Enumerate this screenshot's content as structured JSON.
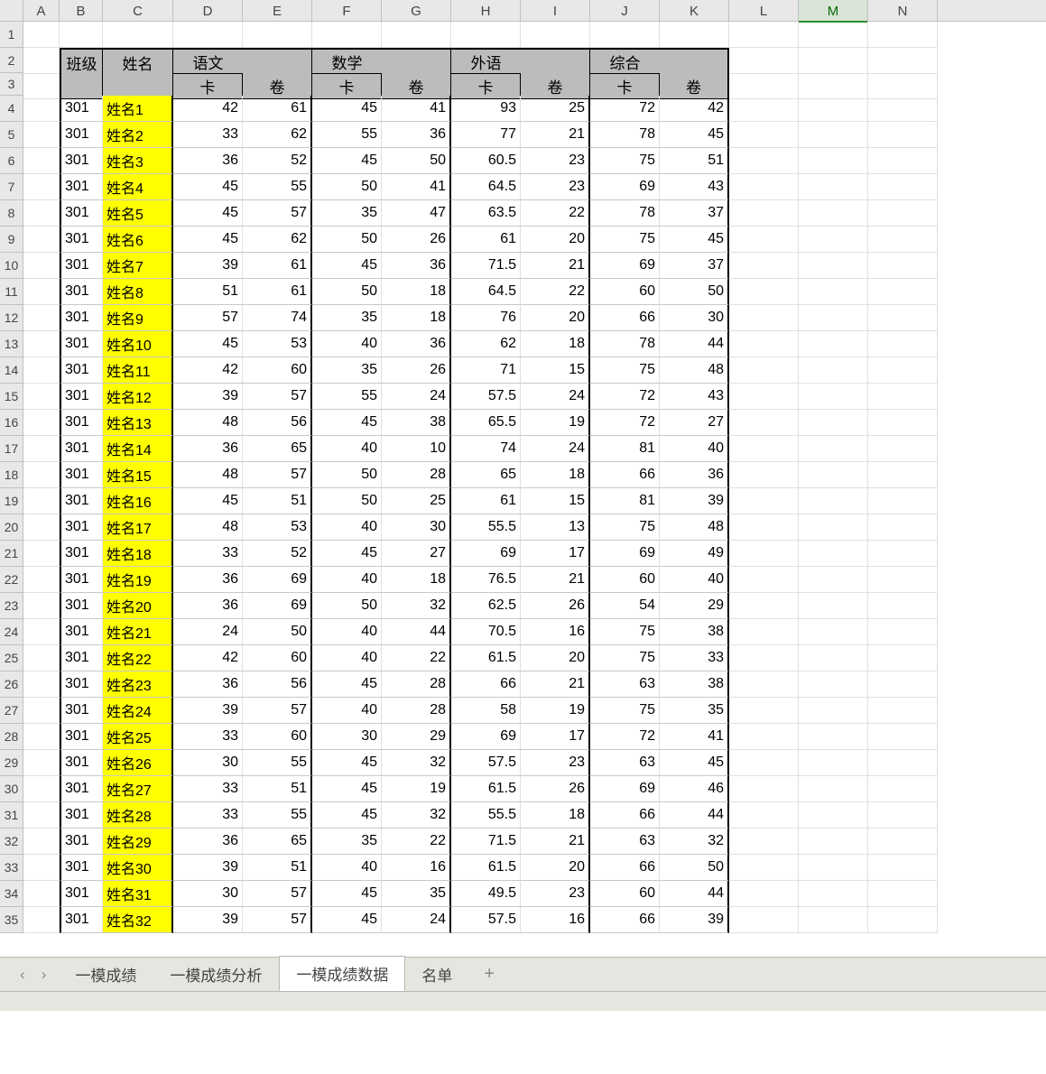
{
  "columns": [
    "A",
    "B",
    "C",
    "D",
    "E",
    "F",
    "G",
    "H",
    "I",
    "J",
    "K",
    "L",
    "M",
    "N"
  ],
  "selected_column": "M",
  "row_numbers_start": 1,
  "row_numbers_end": 35,
  "header": {
    "class_label": "班级",
    "name_label": "姓名",
    "subjects": [
      {
        "label": "语文",
        "sub1": "卡",
        "sub2": "卷"
      },
      {
        "label": "数学",
        "sub1": "卡",
        "sub2": "卷"
      },
      {
        "label": "外语",
        "sub1": "卡",
        "sub2": "卷"
      },
      {
        "label": "综合",
        "sub1": "卡",
        "sub2": "卷"
      }
    ]
  },
  "rows": [
    {
      "class": "301",
      "name": "姓名1",
      "d": 42,
      "e": 61,
      "f": 45,
      "g": 41,
      "h": "93",
      "i": 25,
      "j": 72,
      "k": 42
    },
    {
      "class": "301",
      "name": "姓名2",
      "d": 33,
      "e": 62,
      "f": 55,
      "g": 36,
      "h": "77",
      "i": 21,
      "j": 78,
      "k": 45
    },
    {
      "class": "301",
      "name": "姓名3",
      "d": 36,
      "e": 52,
      "f": 45,
      "g": 50,
      "h": "60.5",
      "i": 23,
      "j": 75,
      "k": 51
    },
    {
      "class": "301",
      "name": "姓名4",
      "d": 45,
      "e": 55,
      "f": 50,
      "g": 41,
      "h": "64.5",
      "i": 23,
      "j": 69,
      "k": 43
    },
    {
      "class": "301",
      "name": "姓名5",
      "d": 45,
      "e": 57,
      "f": 35,
      "g": 47,
      "h": "63.5",
      "i": 22,
      "j": 78,
      "k": 37
    },
    {
      "class": "301",
      "name": "姓名6",
      "d": 45,
      "e": 62,
      "f": 50,
      "g": 26,
      "h": "61",
      "i": 20,
      "j": 75,
      "k": 45
    },
    {
      "class": "301",
      "name": "姓名7",
      "d": 39,
      "e": 61,
      "f": 45,
      "g": 36,
      "h": "71.5",
      "i": 21,
      "j": 69,
      "k": 37
    },
    {
      "class": "301",
      "name": "姓名8",
      "d": 51,
      "e": 61,
      "f": 50,
      "g": 18,
      "h": "64.5",
      "i": 22,
      "j": 60,
      "k": 50
    },
    {
      "class": "301",
      "name": "姓名9",
      "d": 57,
      "e": 74,
      "f": 35,
      "g": 18,
      "h": "76",
      "i": 20,
      "j": 66,
      "k": 30
    },
    {
      "class": "301",
      "name": "姓名10",
      "d": 45,
      "e": 53,
      "f": 40,
      "g": 36,
      "h": "62",
      "i": 18,
      "j": 78,
      "k": 44
    },
    {
      "class": "301",
      "name": "姓名11",
      "d": 42,
      "e": 60,
      "f": 35,
      "g": 26,
      "h": "71",
      "i": 15,
      "j": 75,
      "k": 48
    },
    {
      "class": "301",
      "name": "姓名12",
      "d": 39,
      "e": 57,
      "f": 55,
      "g": 24,
      "h": "57.5",
      "i": 24,
      "j": 72,
      "k": 43
    },
    {
      "class": "301",
      "name": "姓名13",
      "d": 48,
      "e": 56,
      "f": 45,
      "g": 38,
      "h": "65.5",
      "i": 19,
      "j": 72,
      "k": 27
    },
    {
      "class": "301",
      "name": "姓名14",
      "d": 36,
      "e": 65,
      "f": 40,
      "g": 10,
      "h": "74",
      "i": 24,
      "j": 81,
      "k": 40
    },
    {
      "class": "301",
      "name": "姓名15",
      "d": 48,
      "e": 57,
      "f": 50,
      "g": 28,
      "h": "65",
      "i": 18,
      "j": 66,
      "k": 36
    },
    {
      "class": "301",
      "name": "姓名16",
      "d": 45,
      "e": 51,
      "f": 50,
      "g": 25,
      "h": "61",
      "i": 15,
      "j": 81,
      "k": 39
    },
    {
      "class": "301",
      "name": "姓名17",
      "d": 48,
      "e": 53,
      "f": 40,
      "g": 30,
      "h": "55.5",
      "i": 13,
      "j": 75,
      "k": 48
    },
    {
      "class": "301",
      "name": "姓名18",
      "d": 33,
      "e": 52,
      "f": 45,
      "g": 27,
      "h": "69",
      "i": 17,
      "j": 69,
      "k": 49
    },
    {
      "class": "301",
      "name": "姓名19",
      "d": 36,
      "e": 69,
      "f": 40,
      "g": 18,
      "h": "76.5",
      "i": 21,
      "j": 60,
      "k": 40
    },
    {
      "class": "301",
      "name": "姓名20",
      "d": 36,
      "e": 69,
      "f": 50,
      "g": 32,
      "h": "62.5",
      "i": 26,
      "j": 54,
      "k": 29
    },
    {
      "class": "301",
      "name": "姓名21",
      "d": 24,
      "e": 50,
      "f": 40,
      "g": 44,
      "h": "70.5",
      "i": 16,
      "j": 75,
      "k": 38
    },
    {
      "class": "301",
      "name": "姓名22",
      "d": 42,
      "e": 60,
      "f": 40,
      "g": 22,
      "h": "61.5",
      "i": 20,
      "j": 75,
      "k": 33
    },
    {
      "class": "301",
      "name": "姓名23",
      "d": 36,
      "e": 56,
      "f": 45,
      "g": 28,
      "h": "66",
      "i": 21,
      "j": 63,
      "k": 38
    },
    {
      "class": "301",
      "name": "姓名24",
      "d": 39,
      "e": 57,
      "f": 40,
      "g": 28,
      "h": "58",
      "i": 19,
      "j": 75,
      "k": 35
    },
    {
      "class": "301",
      "name": "姓名25",
      "d": 33,
      "e": 60,
      "f": 30,
      "g": 29,
      "h": "69",
      "i": 17,
      "j": 72,
      "k": 41
    },
    {
      "class": "301",
      "name": "姓名26",
      "d": 30,
      "e": 55,
      "f": 45,
      "g": 32,
      "h": "57.5",
      "i": 23,
      "j": 63,
      "k": 45
    },
    {
      "class": "301",
      "name": "姓名27",
      "d": 33,
      "e": 51,
      "f": 45,
      "g": 19,
      "h": "61.5",
      "i": 26,
      "j": 69,
      "k": 46
    },
    {
      "class": "301",
      "name": "姓名28",
      "d": 33,
      "e": 55,
      "f": 45,
      "g": 32,
      "h": "55.5",
      "i": 18,
      "j": 66,
      "k": 44
    },
    {
      "class": "301",
      "name": "姓名29",
      "d": 36,
      "e": 65,
      "f": 35,
      "g": 22,
      "h": "71.5",
      "i": 21,
      "j": 63,
      "k": 32
    },
    {
      "class": "301",
      "name": "姓名30",
      "d": 39,
      "e": 51,
      "f": 40,
      "g": 16,
      "h": "61.5",
      "i": 20,
      "j": 66,
      "k": 50
    },
    {
      "class": "301",
      "name": "姓名31",
      "d": 30,
      "e": 57,
      "f": 45,
      "g": 35,
      "h": "49.5",
      "i": 23,
      "j": 60,
      "k": 44
    },
    {
      "class": "301",
      "name": "姓名32",
      "d": 39,
      "e": 57,
      "f": 45,
      "g": 24,
      "h": "57.5",
      "i": 16,
      "j": 66,
      "k": 39
    }
  ],
  "tabs": {
    "items": [
      "一模成绩",
      "一模成绩分析",
      "一模成绩数据",
      "名单"
    ],
    "active_index": 2,
    "add_label": "+"
  },
  "nav": {
    "prev": "‹",
    "next": "›"
  },
  "status": ""
}
